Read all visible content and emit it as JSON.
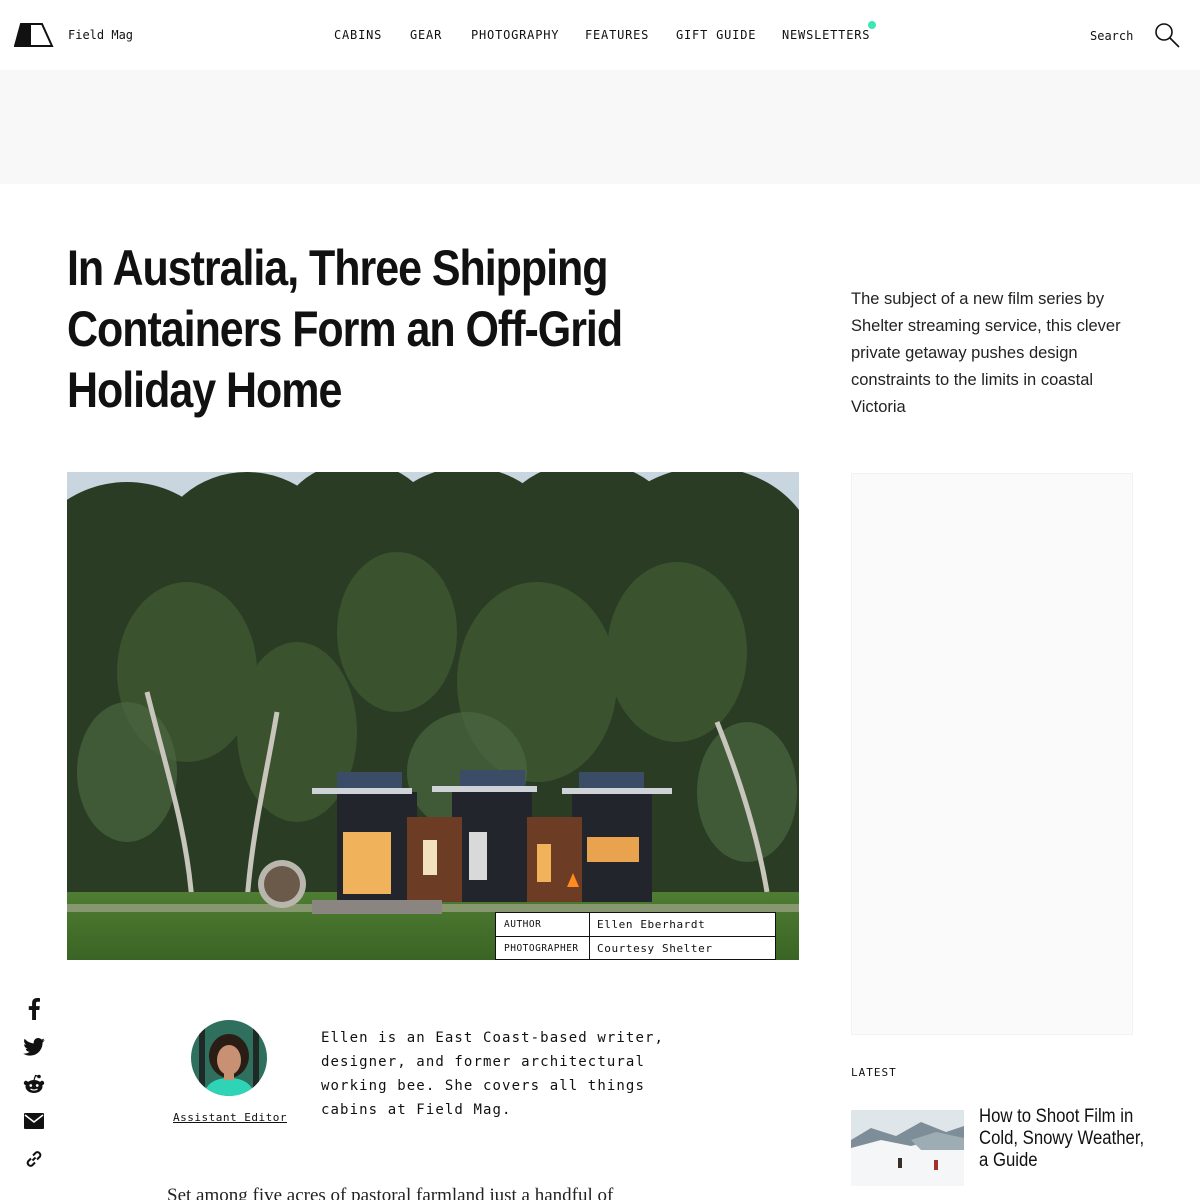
{
  "colors": {
    "accent_dot": "#3ee6b4",
    "text": "#111111",
    "ad_band": "#f8f8f8"
  },
  "header": {
    "brand": "Field Mag",
    "nav": [
      "CABINS",
      "GEAR",
      "PHOTOGRAPHY",
      "FEATURES",
      "GIFT GUIDE",
      "NEWSLETTERS"
    ],
    "search_label": "Search"
  },
  "article": {
    "title": "In Australia, Three Shipping Containers Form an Off-Grid Holiday Home",
    "dek": "The subject of a new film series by Shelter streaming service, this clever private getaway pushes design constraints to the limits in coastal Victoria",
    "credits": [
      {
        "key": "AUTHOR",
        "value": "Ellen Eberhardt"
      },
      {
        "key": "PHOTOGRAPHER",
        "value": "Courtesy Shelter"
      }
    ],
    "author_role": "Assistant Editor",
    "bio": "Ellen is an East Coast-based writer, designer, and former architectural working bee. She covers all things cabins at Field Mag.",
    "body_start": "Set among five acres of pastoral farmland just a handful of"
  },
  "sidebar": {
    "latest_label": "LATEST",
    "latest_items": [
      {
        "title": "How to Shoot Film in Cold, Snowy Weather, a Guide"
      }
    ]
  },
  "share_icons": [
    "facebook-icon",
    "twitter-icon",
    "reddit-icon",
    "email-icon",
    "link-icon"
  ]
}
